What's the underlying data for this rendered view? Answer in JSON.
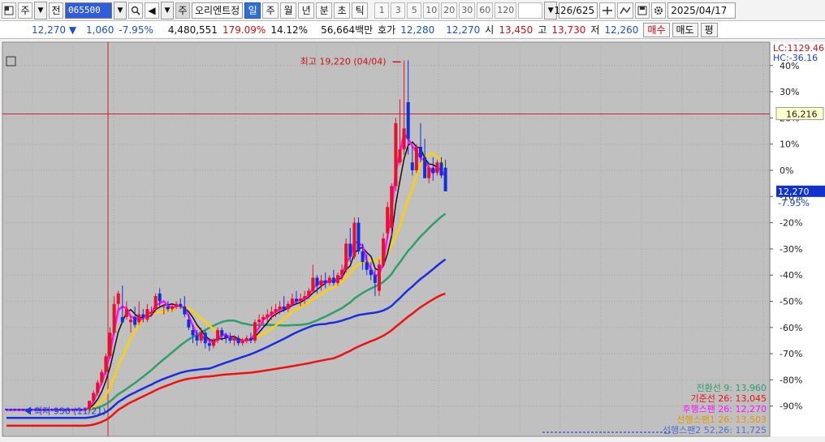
{
  "toolbar": {
    "market_label": "주",
    "type_label": "전",
    "code_value": "065500",
    "stock_name": "오리엔트정",
    "periods": [
      {
        "label": "일",
        "active": true
      },
      {
        "label": "주",
        "active": false
      },
      {
        "label": "월",
        "active": false
      },
      {
        "label": "년",
        "active": false
      },
      {
        "label": "분",
        "active": false
      },
      {
        "label": "초",
        "active": false
      },
      {
        "label": "틱",
        "active": false
      }
    ],
    "intervals": [
      "1",
      "3",
      "5",
      "10",
      "20",
      "30",
      "60",
      "120"
    ],
    "counter": "126/625",
    "date": "2025/04/17"
  },
  "quote": {
    "price": "12,270",
    "change": "1,060",
    "change_pct": "-7.95%",
    "volume": "4,480,551",
    "volume_ratio": "179.09%",
    "turnover": "14.12%",
    "amount": "56,664백만",
    "bid_label": "호가",
    "bid1": "12,280",
    "bid2": "12,270",
    "open_label": "시",
    "open": "13,450",
    "high_label": "고",
    "high": "13,730",
    "low_label": "저",
    "low": "12,260",
    "buy_label": "매수",
    "sell_label": "매도",
    "eval_label": "평"
  },
  "colors": {
    "up": "#e8102a",
    "down": "#1030e0",
    "tenkan": "#111111",
    "kijun": "#ff10ff",
    "chikou": "#ffd000",
    "span1": "#2e9e6a",
    "span2": "#1a2ee0",
    "ma_red": "#ee1111",
    "orange": "#e69500",
    "crosshair": "#d02020",
    "bg": "#c0c0c0"
  },
  "chart_data": {
    "type": "candlestick",
    "y_unit": "%",
    "ylim": [
      -100,
      45
    ],
    "yticks": [
      40,
      30,
      20,
      10,
      0,
      -10,
      -20,
      -30,
      -40,
      -50,
      -60,
      -70,
      -80,
      -90
    ],
    "ytick_labels": [
      "40%",
      "30%",
      "20%",
      "10%",
      "0%",
      "-10%",
      "-20%",
      "-30%",
      "-40%",
      "-50%",
      "-60%",
      "-70%",
      "-80%",
      "-90%"
    ],
    "lc_label": "LC:1129.46",
    "hc_label": "HC:-36.16",
    "crosshair_label": "16,216",
    "crosshair_y": 21.5,
    "current_price_label": "12,270",
    "current_pct_label": "-7.95%",
    "max_annotation": "최고 19,220 (04/04)",
    "min_annotation": "최저 936 (11/21)",
    "legend": [
      {
        "text": "전환선 9: 13,960",
        "color": "#2e9e6a"
      },
      {
        "text": "기준선 26: 13,045",
        "color": "#ee1111"
      },
      {
        "text": "후행스팬 26: 12,270",
        "color": "#ff10ff"
      },
      {
        "text": "선행스팬1 26: 13,503",
        "color": "#e69500"
      },
      {
        "text": "선행스팬2 52,26: 11,725",
        "color": "#5070d0"
      }
    ],
    "candles": [
      {
        "o": -91,
        "h": -91,
        "l": -92,
        "c": -91.5
      },
      {
        "o": -91,
        "h": -91,
        "l": -92,
        "c": -91.5
      },
      {
        "o": -91,
        "h": -91,
        "l": -92,
        "c": -91.5
      },
      {
        "o": -91,
        "h": -91,
        "l": -92,
        "c": -91.5
      },
      {
        "o": -91,
        "h": -91,
        "l": -92,
        "c": -91.5
      },
      {
        "o": -91,
        "h": -91,
        "l": -92,
        "c": -91.5
      },
      {
        "o": -91,
        "h": -91,
        "l": -92,
        "c": -91.5
      },
      {
        "o": -91,
        "h": -91,
        "l": -92,
        "c": -91.5
      },
      {
        "o": -91,
        "h": -91,
        "l": -92,
        "c": -91.5
      },
      {
        "o": -91,
        "h": -91,
        "l": -92,
        "c": -91.5
      },
      {
        "o": -91,
        "h": -91,
        "l": -92,
        "c": -91.5
      },
      {
        "o": -91,
        "h": -91,
        "l": -92,
        "c": -91.5
      },
      {
        "o": -91,
        "h": -91,
        "l": -92,
        "c": -91.5
      },
      {
        "o": -91,
        "h": -91,
        "l": -92,
        "c": -91.5
      },
      {
        "o": -91,
        "h": -91,
        "l": -92,
        "c": -91.5
      },
      {
        "o": -91,
        "h": -91,
        "l": -92,
        "c": -91.5
      },
      {
        "o": -91,
        "h": -91,
        "l": -92,
        "c": -91.5
      },
      {
        "o": -91,
        "h": -91,
        "l": -92,
        "c": -91.5
      },
      {
        "o": -91,
        "h": -91,
        "l": -92,
        "c": -91.5
      },
      {
        "o": -91,
        "h": -91,
        "l": -92,
        "c": -91.5
      },
      {
        "o": -91,
        "h": -88,
        "l": -92,
        "c": -88
      },
      {
        "o": -88,
        "h": -84,
        "l": -89,
        "c": -85
      },
      {
        "o": -85,
        "h": -80,
        "l": -86,
        "c": -81
      },
      {
        "o": -81,
        "h": -76,
        "l": -82,
        "c": -77
      },
      {
        "o": -77,
        "h": -70,
        "l": -78,
        "c": -71
      },
      {
        "o": -71,
        "h": -60,
        "l": -72,
        "c": -62
      },
      {
        "o": -62,
        "h": -48,
        "l": -63,
        "c": -51
      },
      {
        "o": -51,
        "h": -46,
        "l": -53,
        "c": -47
      },
      {
        "o": -56,
        "h": -44,
        "l": -58,
        "c": -58
      },
      {
        "o": -56,
        "h": -50,
        "l": -57,
        "c": -53
      },
      {
        "o": -58,
        "h": -55,
        "l": -62,
        "c": -57
      },
      {
        "o": -56,
        "h": -52,
        "l": -60,
        "c": -59
      },
      {
        "o": -58,
        "h": -50,
        "l": -59,
        "c": -55
      },
      {
        "o": -55,
        "h": -53,
        "l": -58,
        "c": -56
      },
      {
        "o": -57,
        "h": -51,
        "l": -58,
        "c": -53
      },
      {
        "o": -55,
        "h": -52,
        "l": -56,
        "c": -54
      },
      {
        "o": -53,
        "h": -47,
        "l": -54,
        "c": -48
      },
      {
        "o": -47,
        "h": -45,
        "l": -52,
        "c": -50
      },
      {
        "o": -52,
        "h": -51,
        "l": -55,
        "c": -52
      },
      {
        "o": -52,
        "h": -50,
        "l": -54,
        "c": -53
      },
      {
        "o": -53,
        "h": -51,
        "l": -54,
        "c": -52
      },
      {
        "o": -52,
        "h": -50,
        "l": -53,
        "c": -51
      },
      {
        "o": -51,
        "h": -49,
        "l": -53,
        "c": -52
      },
      {
        "o": -52,
        "h": -48,
        "l": -56,
        "c": -55
      },
      {
        "o": -57,
        "h": -55,
        "l": -61,
        "c": -60
      },
      {
        "o": -61,
        "h": -59,
        "l": -66,
        "c": -63
      },
      {
        "o": -63,
        "h": -61,
        "l": -67,
        "c": -65
      },
      {
        "o": -65,
        "h": -60,
        "l": -66,
        "c": -62
      },
      {
        "o": -62,
        "h": -61,
        "l": -68,
        "c": -66
      },
      {
        "o": -66,
        "h": -64,
        "l": -69,
        "c": -67
      },
      {
        "o": -67,
        "h": -64,
        "l": -68,
        "c": -65
      },
      {
        "o": -65,
        "h": -60,
        "l": -66,
        "c": -61
      },
      {
        "o": -61,
        "h": -60,
        "l": -65,
        "c": -63
      },
      {
        "o": -63,
        "h": -62,
        "l": -66,
        "c": -64
      },
      {
        "o": -64,
        "h": -62,
        "l": -66,
        "c": -65
      },
      {
        "o": -65,
        "h": -63,
        "l": -67,
        "c": -64
      },
      {
        "o": -64,
        "h": -63,
        "l": -67,
        "c": -66
      },
      {
        "o": -66,
        "h": -64,
        "l": -67,
        "c": -65
      },
      {
        "o": -65,
        "h": -63,
        "l": -66,
        "c": -64
      },
      {
        "o": -64,
        "h": -62,
        "l": -66,
        "c": -65
      },
      {
        "o": -65,
        "h": -57,
        "l": -66,
        "c": -58
      },
      {
        "o": -58,
        "h": -55,
        "l": -60,
        "c": -57
      },
      {
        "o": -57,
        "h": -55,
        "l": -59,
        "c": -56
      },
      {
        "o": -56,
        "h": -53,
        "l": -58,
        "c": -55
      },
      {
        "o": -55,
        "h": -52,
        "l": -57,
        "c": -54
      },
      {
        "o": -54,
        "h": -51,
        "l": -56,
        "c": -53
      },
      {
        "o": -53,
        "h": -50,
        "l": -55,
        "c": -52
      },
      {
        "o": -52,
        "h": -48,
        "l": -54,
        "c": -53
      },
      {
        "o": -53,
        "h": -50,
        "l": -54,
        "c": -51
      },
      {
        "o": -51,
        "h": -47,
        "l": -52,
        "c": -49
      },
      {
        "o": -49,
        "h": -46,
        "l": -51,
        "c": -50
      },
      {
        "o": -50,
        "h": -47,
        "l": -52,
        "c": -49
      },
      {
        "o": -49,
        "h": -46,
        "l": -51,
        "c": -48
      },
      {
        "o": -48,
        "h": -45,
        "l": -49,
        "c": -46
      },
      {
        "o": -46,
        "h": -36,
        "l": -47,
        "c": -41
      },
      {
        "o": -41,
        "h": -40,
        "l": -47,
        "c": -44
      },
      {
        "o": -44,
        "h": -40,
        "l": -46,
        "c": -42
      },
      {
        "o": -42,
        "h": -39,
        "l": -45,
        "c": -43
      },
      {
        "o": -43,
        "h": -40,
        "l": -44,
        "c": -41
      },
      {
        "o": -41,
        "h": -38,
        "l": -44,
        "c": -43
      },
      {
        "o": -43,
        "h": -39,
        "l": -44,
        "c": -40
      },
      {
        "o": -40,
        "h": -36,
        "l": -42,
        "c": -38
      },
      {
        "o": -38,
        "h": -26,
        "l": -39,
        "c": -28
      },
      {
        "o": -28,
        "h": -22,
        "l": -35,
        "c": -33
      },
      {
        "o": -33,
        "h": -18,
        "l": -34,
        "c": -20
      },
      {
        "o": -20,
        "h": -18,
        "l": -32,
        "c": -31
      },
      {
        "o": -31,
        "h": -28,
        "l": -38,
        "c": -35
      },
      {
        "o": -35,
        "h": -32,
        "l": -40,
        "c": -38
      },
      {
        "o": -38,
        "h": -35,
        "l": -42,
        "c": -40
      },
      {
        "o": -40,
        "h": -37,
        "l": -48,
        "c": -43
      },
      {
        "o": -46,
        "h": -34,
        "l": -48,
        "c": -36
      },
      {
        "o": -36,
        "h": -24,
        "l": -37,
        "c": -26
      },
      {
        "o": -24,
        "h": -12,
        "l": -26,
        "c": -14
      },
      {
        "o": -22,
        "h": -5,
        "l": -25,
        "c": -6
      },
      {
        "o": -6,
        "h": 20,
        "l": -8,
        "c": 18
      },
      {
        "o": 3,
        "h": 27,
        "l": 2,
        "c": 8
      },
      {
        "o": 8,
        "h": 42,
        "l": 6,
        "c": 16
      },
      {
        "o": 26,
        "h": 42,
        "l": 6,
        "c": 12
      },
      {
        "o": 3,
        "h": 9,
        "l": -2,
        "c": 0
      },
      {
        "o": 0,
        "h": 10,
        "l": -1,
        "c": 9
      },
      {
        "o": 9,
        "h": 18,
        "l": 3,
        "c": 5
      },
      {
        "o": 5,
        "h": 12,
        "l": -2,
        "c": -3
      },
      {
        "o": -3,
        "h": 2,
        "l": -5,
        "c": 1
      },
      {
        "o": 1,
        "h": 5,
        "l": -4,
        "c": -1
      },
      {
        "o": -1,
        "h": 4,
        "l": -2,
        "c": 3
      },
      {
        "o": 3,
        "h": 5,
        "l": -3,
        "c": -2
      },
      {
        "o": 1,
        "h": 4,
        "l": -8,
        "c": -8
      }
    ]
  }
}
